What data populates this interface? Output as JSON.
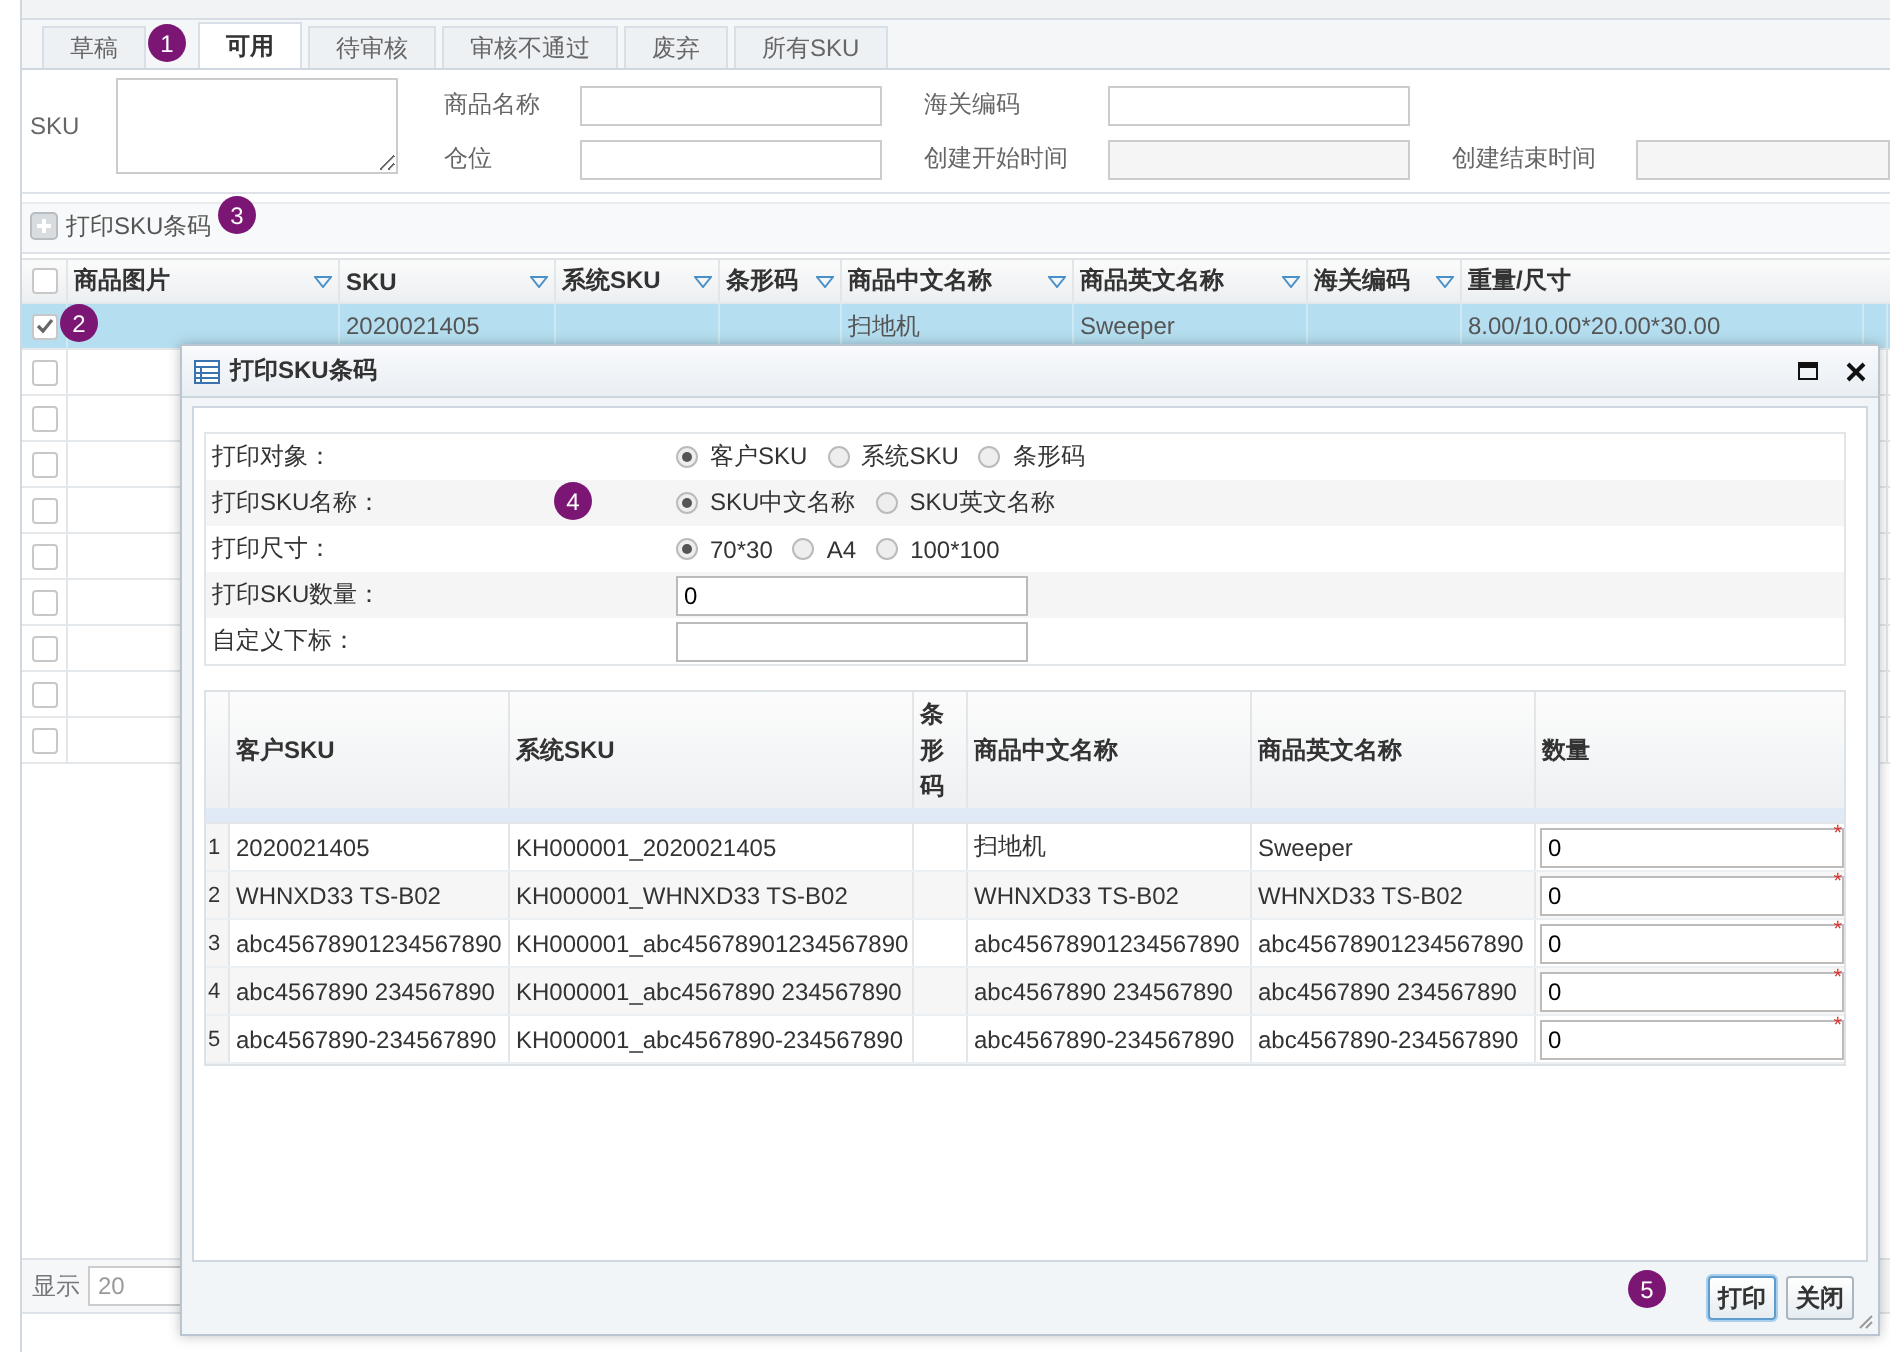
{
  "tabs": [
    {
      "label": "草稿",
      "selected": false
    },
    {
      "label": "可用",
      "selected": true
    },
    {
      "label": "待审核",
      "selected": false
    },
    {
      "label": "审核不通过",
      "selected": false
    },
    {
      "label": "废弃",
      "selected": false
    },
    {
      "label": "所有SKU",
      "selected": false
    }
  ],
  "filters": [
    {
      "label": "SKU",
      "kind": "textarea"
    },
    {
      "label": "商品名称",
      "kind": "input"
    },
    {
      "label": "海关编码",
      "kind": "input"
    },
    {
      "label": "仓位",
      "kind": "input"
    },
    {
      "label": "创建开始时间",
      "kind": "date"
    },
    {
      "label": "创建结束时间",
      "kind": "date"
    }
  ],
  "toolbar": {
    "label": "打印SKU条码"
  },
  "grid": {
    "all_selected": false,
    "columns": [
      "商品图片",
      "SKU",
      "系统SKU",
      "条形码",
      "商品中文名称",
      "商品英文名称",
      "海关编码",
      "重量/尺寸"
    ],
    "rows": [
      {
        "selected": true,
        "sku": "2020021405",
        "chinese_name": "扫地机",
        "english_name": "Sweeper",
        "weight_size": "8.00/10.00*20.00*30.00"
      },
      {
        "selected": false
      },
      {
        "selected": false
      },
      {
        "selected": false
      },
      {
        "selected": false
      },
      {
        "selected": false
      },
      {
        "selected": false
      },
      {
        "selected": false
      },
      {
        "selected": false
      },
      {
        "selected": false
      }
    ]
  },
  "pager": {
    "label": "显示",
    "page_size": "20"
  },
  "dialog": {
    "title": "打印SKU条码",
    "options": [
      {
        "label": "打印对象：",
        "kind": "radio",
        "choices": [
          {
            "label": "客户SKU",
            "selected": true
          },
          {
            "label": "系统SKU",
            "selected": false
          },
          {
            "label": "条形码",
            "selected": false
          }
        ]
      },
      {
        "label": "打印SKU名称：",
        "kind": "radio",
        "choices": [
          {
            "label": "SKU中文名称",
            "selected": true
          },
          {
            "label": "SKU英文名称",
            "selected": false
          }
        ]
      },
      {
        "label": "打印尺寸：",
        "kind": "radio",
        "choices": [
          {
            "label": "70*30",
            "selected": true
          },
          {
            "label": "A4",
            "selected": false
          },
          {
            "label": "100*100",
            "selected": false
          }
        ]
      },
      {
        "label": "打印SKU数量：",
        "kind": "input",
        "value": "0"
      },
      {
        "label": "自定义下标：",
        "kind": "input"
      }
    ],
    "table": {
      "columns": [
        "客户SKU",
        "系统SKU",
        "条形码",
        "商品中文名称",
        "商品英文名称",
        "数量"
      ],
      "rows": [
        {
          "number": "1",
          "customer_sku": "2020021405",
          "system_sku": "KH000001_2020021405",
          "chinese_name": "扫地机",
          "english_name": "Sweeper",
          "quantity": "0",
          "marker": "*"
        },
        {
          "number": "2",
          "customer_sku": "WHNXD33 TS-B02",
          "system_sku": "KH000001_WHNXD33 TS-B02",
          "chinese_name": "WHNXD33 TS-B02",
          "english_name": "WHNXD33 TS-B02",
          "quantity": "0",
          "marker": "*"
        },
        {
          "number": "3",
          "customer_sku": "abc45678901234567890",
          "system_sku": "KH000001_abc45678901234567890",
          "chinese_name": "abc45678901234567890",
          "english_name": "abc45678901234567890",
          "quantity": "0",
          "marker": "*"
        },
        {
          "number": "4",
          "customer_sku": "abc4567890 234567890",
          "system_sku": "KH000001_abc4567890 234567890",
          "chinese_name": "abc4567890 234567890",
          "english_name": "abc4567890 234567890",
          "quantity": "0",
          "marker": "*"
        },
        {
          "number": "5",
          "customer_sku": "abc4567890-234567890",
          "system_sku": "KH000001_abc4567890-234567890",
          "chinese_name": "abc4567890-234567890",
          "english_name": "abc4567890-234567890",
          "quantity": "0",
          "marker": "*"
        }
      ]
    },
    "buttons": [
      {
        "label": "打印",
        "focused": true
      },
      {
        "label": "关闭",
        "focused": false
      }
    ]
  },
  "annotations": [
    {
      "label": "1"
    },
    {
      "label": "2"
    },
    {
      "label": "3"
    },
    {
      "label": "4"
    },
    {
      "label": "5"
    }
  ]
}
